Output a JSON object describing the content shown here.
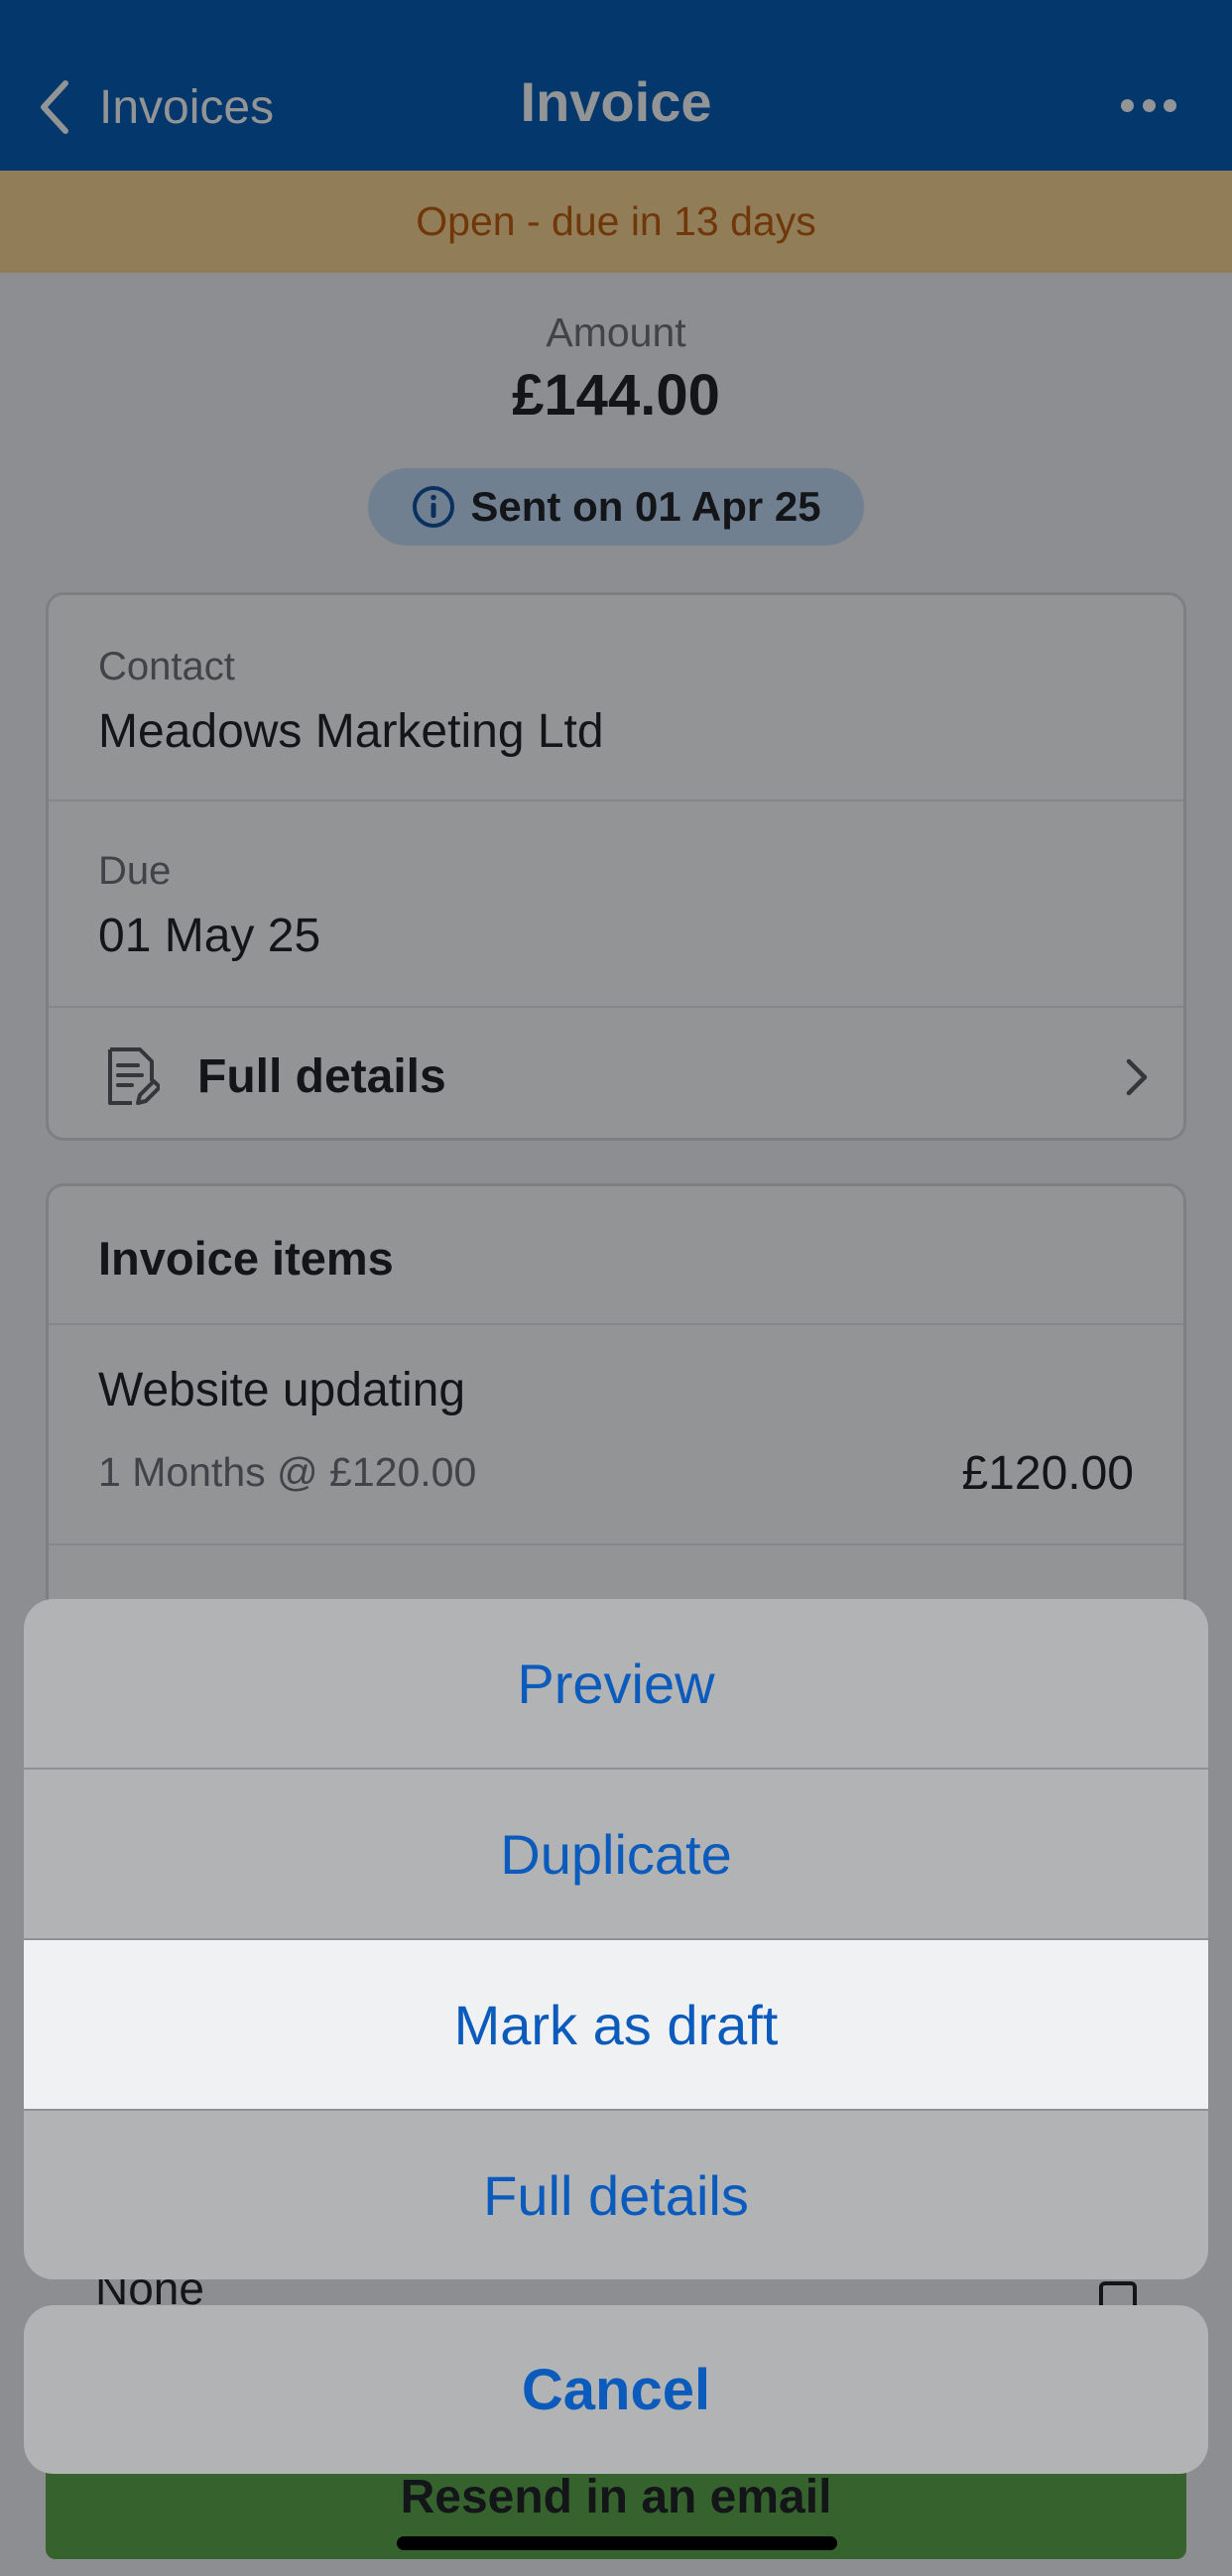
{
  "header": {
    "back_label": "Invoices",
    "title": "Invoice",
    "bg_color": "#005ab4"
  },
  "status_banner": {
    "text": "Open - due in 13 days"
  },
  "summary": {
    "amount_label": "Amount",
    "amount_value": "£144.00",
    "sent_text": "Sent on 01 Apr 25"
  },
  "details": {
    "contact_label": "Contact",
    "contact_value": "Meadows Marketing Ltd",
    "due_label": "Due",
    "due_value": "01 May 25",
    "full_details_label": "Full details"
  },
  "invoice_items": {
    "title": "Invoice items",
    "items": [
      {
        "name": "Website updating",
        "desc": "1 Months @ £120.00",
        "amount": "£120.00"
      }
    ]
  },
  "partial": {
    "none_text": "None",
    "resend_label": "Resend in an email"
  },
  "action_sheet": {
    "items": [
      {
        "label": "Preview"
      },
      {
        "label": "Duplicate"
      },
      {
        "label": "Mark as draft",
        "highlighted": true
      },
      {
        "label": "Full details"
      }
    ],
    "cancel_label": "Cancel",
    "text_color": "#0b5bbd"
  }
}
